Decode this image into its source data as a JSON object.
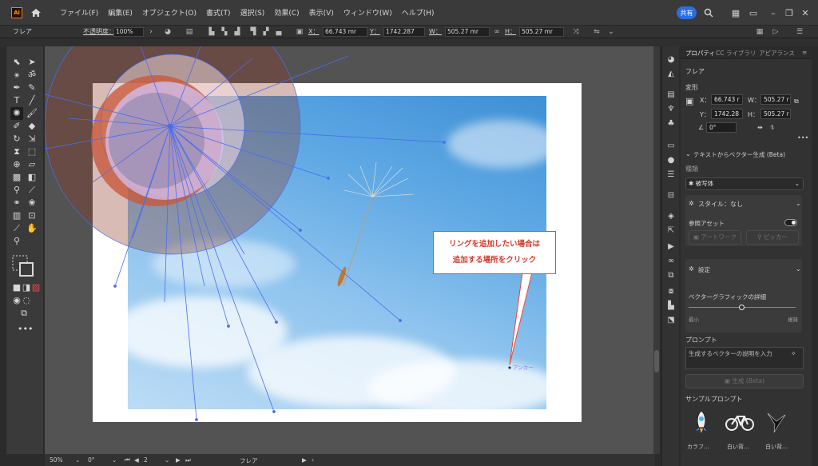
{
  "app": {
    "logo": "Ai"
  },
  "menu": [
    "ファイル(F)",
    "編集(E)",
    "オブジェクト(O)",
    "書式(T)",
    "選択(S)",
    "効果(C)",
    "表示(V)",
    "ウィンドウ(W)",
    "ヘルプ(H)"
  ],
  "menubar_right": {
    "share_label": "共有"
  },
  "control": {
    "selection": "フレア",
    "opacity_label": "不透明度：",
    "opacity_value": "100%",
    "x_label": "X：",
    "x_value": "66.743 mr",
    "y_label": "Y：",
    "y_value": "1742.287",
    "w_label": "W：",
    "w_value": "505.27 mr",
    "h_label": "H：",
    "h_value": "505.27 mr"
  },
  "canvas": {
    "callout_line1": "リングを追加したい場合は",
    "callout_line2": "追加する場所をクリック",
    "anchor_label": "アンカー",
    "accent_red": "#e8493a",
    "sky_blue": "#5ea8e4",
    "flare_stroke": "#4a6df0"
  },
  "status": {
    "zoom": "50%",
    "rotation": "0°",
    "artboard": "2",
    "tool": "フレア"
  },
  "right_panel": {
    "tabs": [
      "プロパティ",
      "CC ライブラリ",
      "アピアランス"
    ],
    "object": "フレア",
    "transform_title": "変形",
    "x_label": "X：",
    "x_value": "66.743 r",
    "y_label": "Y：",
    "y_value": "1742.28",
    "w_label": "W：",
    "w_value": "505.27 r",
    "h_label": "H：",
    "h_value": "505.27 r",
    "angle_value": "0°",
    "text_to_vector_title": "テキストからベクター生成 (Beta)",
    "type_label": "種類",
    "type_value": "被写体",
    "style_label": "スタイル：なし",
    "ref_asset_label": "参照アセット",
    "artwork_btn": "アートワーク",
    "picker_btn": "ピッカー",
    "settings_label": "設定",
    "detail_label": "ベクターグラフィックの詳細",
    "slider_min": "最小",
    "slider_max": "複雑",
    "slider_level": 0.5,
    "prompt_label": "プロンプト",
    "prompt_placeholder": "生成するベクターの説明を入力",
    "generate_btn": "生成 (Beta)",
    "sample_title": "サンプルプロンプト",
    "samples": [
      "カラフ...",
      "白い背...",
      "白い背..."
    ]
  }
}
